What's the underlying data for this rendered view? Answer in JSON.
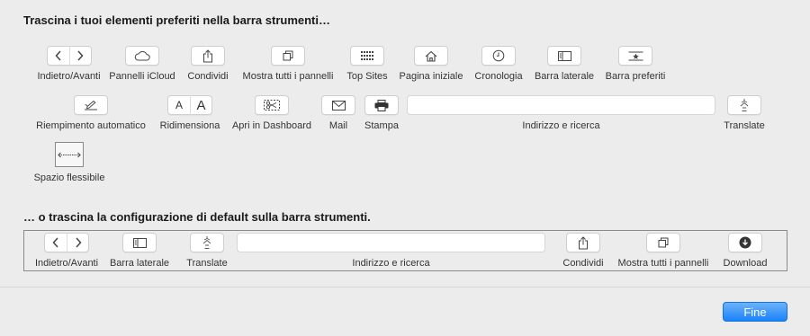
{
  "palette_title": "Trascina i tuoi elementi preferiti nella barra strumenti…",
  "items": {
    "back_forward": "Indietro/Avanti",
    "icloud": "Pannelli iCloud",
    "share": "Condividi",
    "show_all_tabs": "Mostra tutti i pannelli",
    "top_sites": "Top Sites",
    "home": "Pagina iniziale",
    "history": "Cronologia",
    "sidebar": "Barra laterale",
    "favorites": "Barra preferiti",
    "autofill": "Riempimento automatico",
    "text_size": "Ridimensiona",
    "text_size_small": "A",
    "text_size_large": "A",
    "dashboard": "Apri in Dashboard",
    "mail": "Mail",
    "print": "Stampa",
    "address": "Indirizzo e ricerca",
    "translate": "Translate",
    "flexible_space": "Spazio flessibile"
  },
  "default_title": "… o trascina la configurazione di default sulla barra strumenti.",
  "default_set": {
    "back_forward": "Indietro/Avanti",
    "sidebar": "Barra laterale",
    "translate": "Translate",
    "address": "Indirizzo e ricerca",
    "share": "Condividi",
    "show_all_tabs": "Mostra tutti i pannelli",
    "download": "Download"
  },
  "done_label": "Fine",
  "colors": {
    "accent": "#1a82fb",
    "background": "#ececec"
  }
}
